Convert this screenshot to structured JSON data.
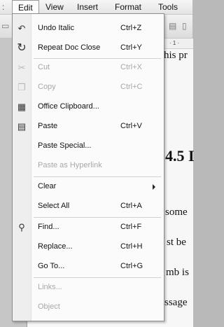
{
  "menubar": {
    "items": [
      "Edit",
      "View",
      "Insert",
      "Format",
      "Tools"
    ]
  },
  "document": {
    "ruler_text": "· 1 ·",
    "line1": "his pr",
    "heading": "4.5 I",
    "line2": "some",
    "line3": "st be",
    "line4": "mb is",
    "line5": "ssage"
  },
  "menu": {
    "items": [
      {
        "label": "Undo Italic",
        "shortcut": "Ctrl+Z",
        "icon": "undo-icon",
        "enabled": true
      },
      {
        "label": "Repeat Doc Close",
        "shortcut": "Ctrl+Y",
        "icon": "repeat-icon",
        "enabled": true
      },
      {
        "label": "Cut",
        "shortcut": "Ctrl+X",
        "icon": "scissors-icon",
        "enabled": false
      },
      {
        "label": "Copy",
        "shortcut": "Ctrl+C",
        "icon": "copy-icon",
        "enabled": false
      },
      {
        "label": "Office Clipboard...",
        "shortcut": "",
        "icon": "clipboard-icon",
        "enabled": true
      },
      {
        "label": "Paste",
        "shortcut": "Ctrl+V",
        "icon": "paste-icon",
        "enabled": true
      },
      {
        "label": "Paste Special...",
        "shortcut": "",
        "icon": "",
        "enabled": true
      },
      {
        "label": "Paste as Hyperlink",
        "shortcut": "",
        "icon": "",
        "enabled": false
      },
      {
        "label": "Clear",
        "shortcut": "",
        "icon": "",
        "enabled": true,
        "submenu": true
      },
      {
        "label": "Select All",
        "shortcut": "Ctrl+A",
        "icon": "",
        "enabled": true
      },
      {
        "label": "Find...",
        "shortcut": "Ctrl+F",
        "icon": "binoculars-icon",
        "enabled": true
      },
      {
        "label": "Replace...",
        "shortcut": "Ctrl+H",
        "icon": "",
        "enabled": true
      },
      {
        "label": "Go To...",
        "shortcut": "Ctrl+G",
        "icon": "",
        "enabled": true
      },
      {
        "label": "Links...",
        "shortcut": "",
        "icon": "",
        "enabled": false
      },
      {
        "label": "Object",
        "shortcut": "",
        "icon": "",
        "enabled": false
      }
    ]
  }
}
